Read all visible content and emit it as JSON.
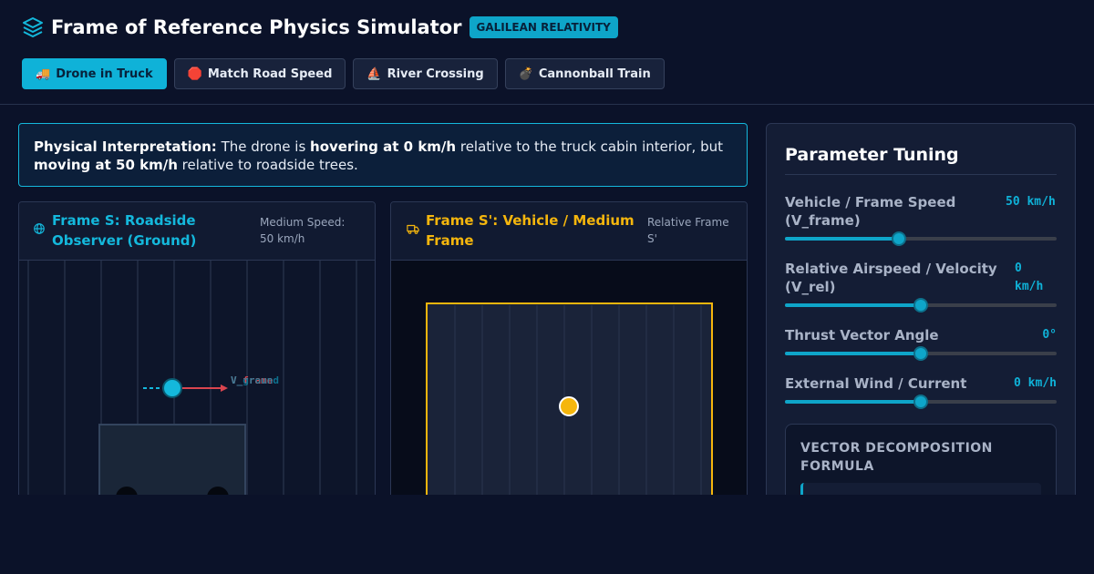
{
  "app": {
    "title": "Frame of Reference Physics Simulator",
    "badge": "GALILEAN RELATIVITY",
    "logo_icon": "layers-icon"
  },
  "tabs": [
    {
      "emoji": "🚚",
      "label": "Drone in Truck",
      "active": true
    },
    {
      "emoji": "🛑",
      "label": "Match Road Speed",
      "active": false
    },
    {
      "emoji": "⛵",
      "label": "River Crossing",
      "active": false
    },
    {
      "emoji": "💣",
      "label": "Cannonball Train",
      "active": false
    }
  ],
  "interpretation": {
    "label": "Physical Interpretation:",
    "t1": " The drone is ",
    "b1": "hovering at 0 km/h",
    "t2": " relative to the truck cabin interior, but ",
    "b2": "moving at 50 km/h",
    "t3": " relative to roadside trees."
  },
  "frame_s": {
    "title": "Frame S: Roadside Observer (Ground)",
    "subtitle": "Medium Speed: 50 km/h",
    "icon": "globe-icon",
    "vector_label_1": "V_frame",
    "vector_label_2": "V_ground",
    "color": "#14b8dc"
  },
  "frame_s_prime": {
    "title": "Frame S': Vehicle / Medium Frame",
    "subtitle": "Relative Frame S'",
    "icon": "truck-icon",
    "color": "#f5b60d"
  },
  "controls": {
    "title": "Parameter Tuning",
    "params": [
      {
        "label": "Vehicle / Frame Speed (V_frame)",
        "value": "50 km/h",
        "level": 0.42
      },
      {
        "label": "Relative Airspeed / Velocity (V_rel)",
        "value": "0 km/h",
        "level": 0.5
      },
      {
        "label": "Thrust Vector Angle",
        "value": "0°",
        "level": 0.5
      },
      {
        "label": "External Wind / Current",
        "value": "0 km/h",
        "level": 0.5
      }
    ],
    "formula_title": "VECTOR DECOMPOSITION FORMULA"
  }
}
